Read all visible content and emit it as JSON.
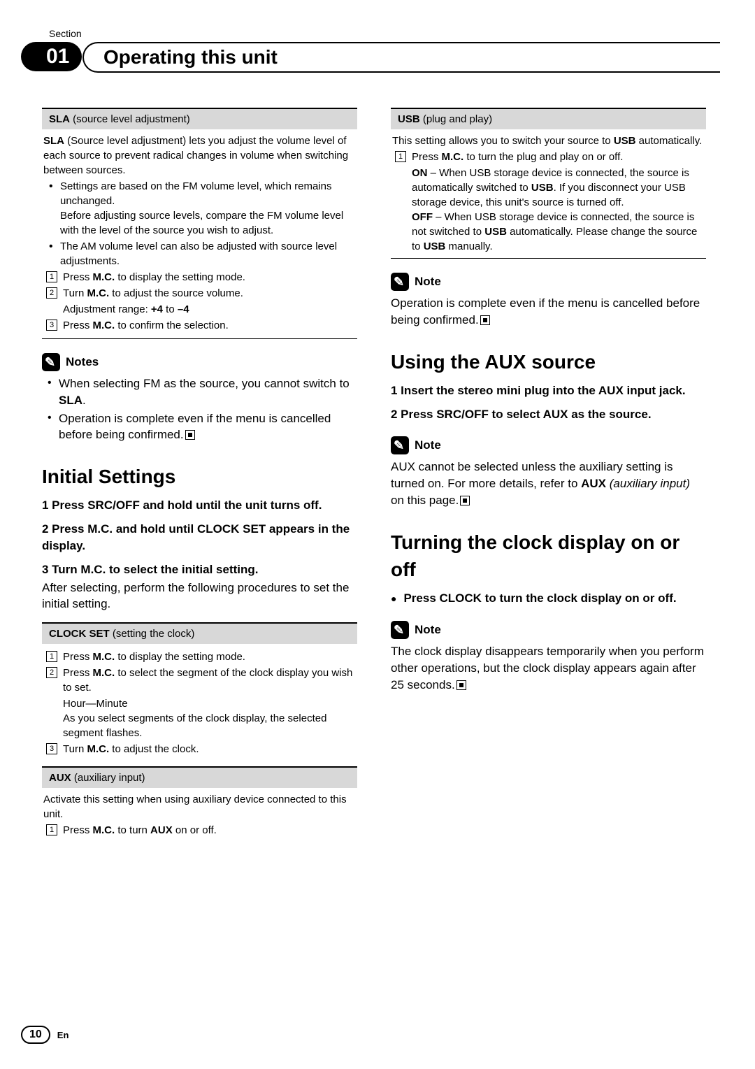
{
  "header": {
    "section_label": "Section",
    "section_number": "01",
    "title": "Operating this unit"
  },
  "left": {
    "sla": {
      "header_bold": "SLA",
      "header_rest": " (source level adjustment)",
      "intro_a": "SLA",
      "intro_b": " (Source level adjustment) lets you adjust the volume level of each source to prevent radical changes in volume when switching between sources.",
      "b1a": "Settings are based on the FM volume level, which remains unchanged.",
      "b1b": "Before adjusting source levels, compare the FM volume level with the level of the source you wish to adjust.",
      "b2": "The AM volume level can also be adjusted with source level adjustments.",
      "s1_a": "Press ",
      "s1_b": "M.C.",
      "s1_c": " to display the setting mode.",
      "s2_a": "Turn ",
      "s2_b": "M.C.",
      "s2_c": " to adjust the source volume.",
      "s2_d": "Adjustment range: ",
      "s2_e": "+4",
      "s2_f": " to ",
      "s2_g": "–4",
      "s3_a": "Press ",
      "s3_b": "M.C.",
      "s3_c": " to confirm the selection."
    },
    "notes": {
      "title": "Notes",
      "n1_a": "When selecting FM as the source, you cannot switch to ",
      "n1_b": "SLA",
      "n1_c": ".",
      "n2": "Operation is complete even if the menu is cancelled before being confirmed."
    },
    "initial": {
      "title": "Initial Settings",
      "s1": "1   Press SRC/OFF and hold until the unit turns off.",
      "s2": "2   Press M.C. and hold until CLOCK SET appears in the display.",
      "s3": "3   Turn M.C. to select the initial setting.",
      "s3_after": "After selecting, perform the following procedures to set the initial setting."
    },
    "clock": {
      "header_bold": "CLOCK SET",
      "header_rest": " (setting the clock)",
      "s1_a": "Press ",
      "s1_b": "M.C.",
      "s1_c": " to display the setting mode.",
      "s2_a": "Press ",
      "s2_b": "M.C.",
      "s2_c": " to select the segment of the clock display you wish to set.",
      "s2_d": "Hour—Minute",
      "s2_e": "As you select segments of the clock display, the selected segment flashes.",
      "s3_a": "Turn ",
      "s3_b": "M.C.",
      "s3_c": " to adjust the clock."
    },
    "aux": {
      "header_bold": "AUX",
      "header_rest": " (auxiliary input)",
      "intro": "Activate this setting when using auxiliary device connected to this unit.",
      "s1_a": "Press ",
      "s1_b": "M.C.",
      "s1_c": " to turn ",
      "s1_d": "AUX",
      "s1_e": " on or off."
    }
  },
  "right": {
    "usb": {
      "header_bold": "USB",
      "header_rest": " (plug and play)",
      "intro_a": "This setting allows you to switch your source to ",
      "intro_b": "USB",
      "intro_c": " automatically.",
      "s1_a": "Press ",
      "s1_b": "M.C.",
      "s1_c": " to turn the plug and play on or off.",
      "on_a": "ON",
      "on_b": " – When USB storage device is connected, the source is automatically switched to ",
      "on_c": "USB",
      "on_d": ". If you disconnect your USB storage device, this unit's source is turned off.",
      "off_a": "OFF",
      "off_b": " – When USB storage device is connected, the source is not switched to ",
      "off_c": "USB",
      "off_d": " automatically. Please change the source to ",
      "off_e": "USB",
      "off_f": " manually."
    },
    "note1": {
      "title": "Note",
      "body": "Operation is complete even if the menu is cancelled before being confirmed."
    },
    "aux_src": {
      "title": "Using the AUX source",
      "s1": "1   Insert the stereo mini plug into the AUX input jack.",
      "s2": "2   Press SRC/OFF to select AUX as the source."
    },
    "note2": {
      "title": "Note",
      "body_a": "AUX cannot be selected unless the auxiliary setting is turned on. For more details, refer to ",
      "body_b": "AUX",
      "body_c": " (auxiliary input)",
      "body_d": " on this page."
    },
    "clock_disp": {
      "title": "Turning the clock display on or off",
      "s1": "Press CLOCK to turn the clock display on or off."
    },
    "note3": {
      "title": "Note",
      "body": "The clock display disappears temporarily when you perform other operations, but the clock display appears again after 25 seconds."
    }
  },
  "footer": {
    "page": "10",
    "lang": "En"
  },
  "nums": {
    "n1": "1",
    "n2": "2",
    "n3": "3"
  }
}
